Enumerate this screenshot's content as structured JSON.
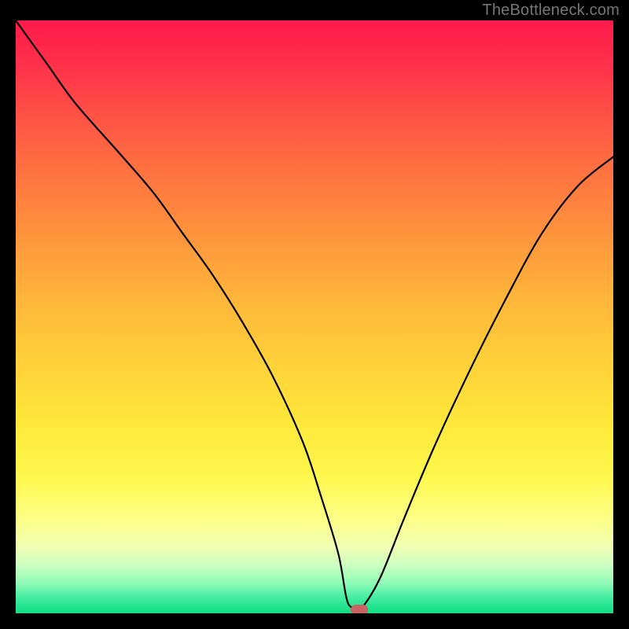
{
  "watermark": "TheBottleneck.com",
  "colors": {
    "background": "#000000",
    "marker": "#c86464",
    "curve": "#000000",
    "label": "#767676"
  },
  "chart_data": {
    "type": "line",
    "title": "",
    "xlabel": "",
    "ylabel": "",
    "xlim": [
      0,
      100
    ],
    "ylim": [
      0,
      100
    ],
    "grid": false,
    "legend": false,
    "series": [
      {
        "name": "bottleneck-curve",
        "x": [
          0,
          5,
          10,
          17,
          23,
          28,
          33,
          38,
          43,
          48,
          51,
          54,
          55.5,
          57,
          58,
          61,
          65,
          70,
          76,
          82,
          88,
          94,
          100
        ],
        "y": [
          100,
          93,
          86,
          78,
          71,
          64,
          57,
          49,
          40,
          29,
          20,
          10,
          2,
          1,
          1,
          6,
          16,
          28,
          41,
          53,
          64,
          72,
          77
        ]
      }
    ],
    "marker": {
      "x": 57.5,
      "y": 0.7
    },
    "background_gradient": {
      "top": "#ff1a4b",
      "mid": "#ffe83b",
      "bottom": "#14e084"
    }
  }
}
